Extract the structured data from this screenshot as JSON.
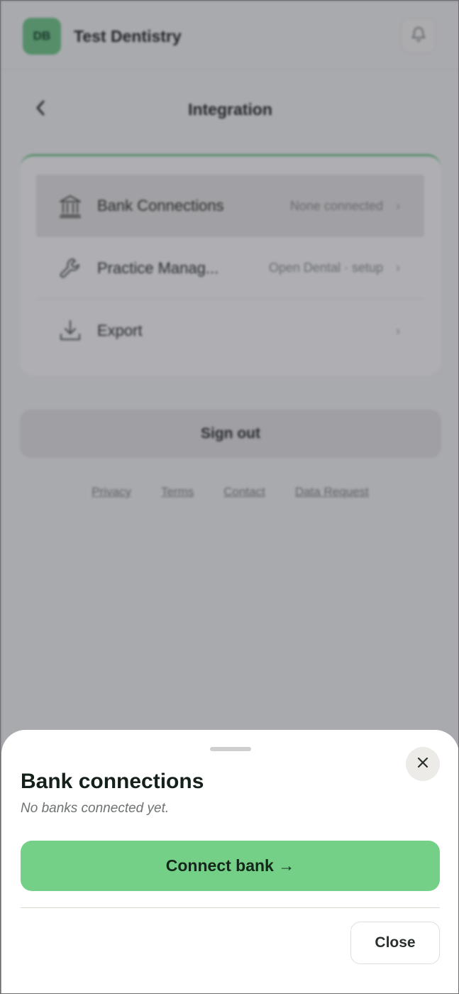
{
  "header": {
    "avatar_initials": "DB",
    "org_name": "Test Dentistry"
  },
  "screen": {
    "title": "Integration"
  },
  "integrations": [
    {
      "icon": "bank-icon",
      "label": "Bank Connections",
      "value": "None connected"
    },
    {
      "icon": "wrench-icon",
      "label": "Practice Manag...",
      "value": "Open Dental · setup"
    },
    {
      "icon": "download-icon",
      "label": "Export",
      "value": ""
    }
  ],
  "sign_out_label": "Sign out",
  "footer_links": [
    "Privacy",
    "Terms",
    "Contact",
    "Data Request"
  ],
  "sheet": {
    "title": "Bank connections",
    "subtitle": "No banks connected yet.",
    "connect_label": "Connect bank →",
    "close_label": "Close"
  },
  "colors": {
    "accent": "#74d087",
    "accent_dark": "#6fc98a"
  }
}
